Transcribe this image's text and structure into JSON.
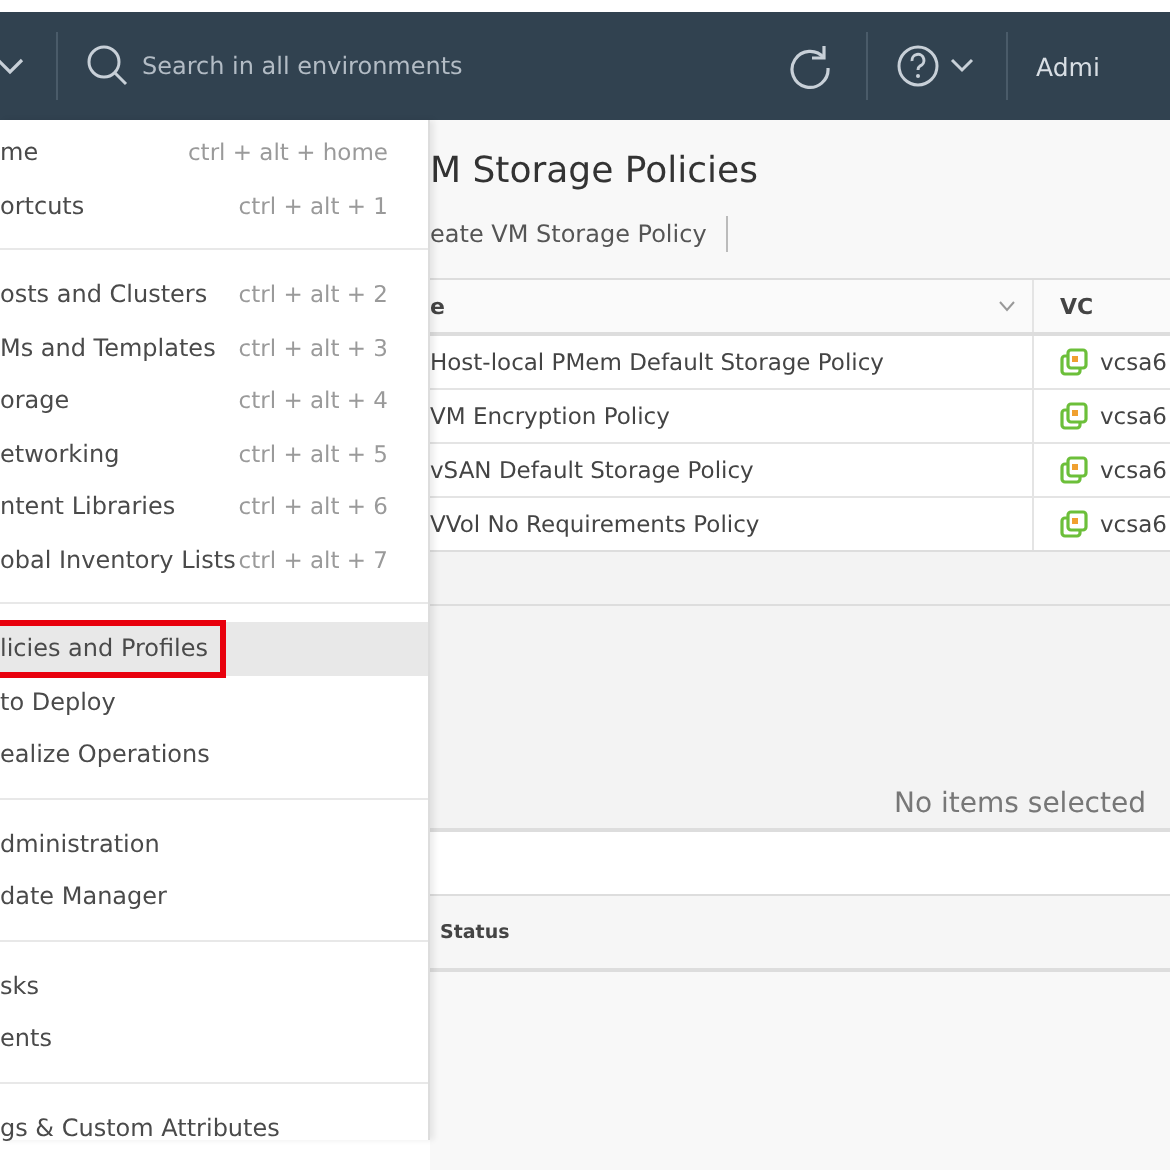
{
  "header": {
    "search": {
      "placeholder": "Search in all environments"
    },
    "user": "Admi"
  },
  "menu": {
    "groups": [
      [
        {
          "label": "me",
          "shortcut": "ctrl + alt + home",
          "selected": false,
          "highlighted": false
        },
        {
          "label": "ortcuts",
          "shortcut": "ctrl + alt + 1",
          "selected": false,
          "highlighted": false
        }
      ],
      [
        {
          "label": "osts and Clusters",
          "shortcut": "ctrl + alt + 2",
          "selected": false,
          "highlighted": false
        },
        {
          "label": "Ms and Templates",
          "shortcut": "ctrl + alt + 3",
          "selected": false,
          "highlighted": false
        },
        {
          "label": "orage",
          "shortcut": "ctrl + alt + 4",
          "selected": false,
          "highlighted": false
        },
        {
          "label": "etworking",
          "shortcut": "ctrl + alt + 5",
          "selected": false,
          "highlighted": false
        },
        {
          "label": "ntent Libraries",
          "shortcut": "ctrl + alt + 6",
          "selected": false,
          "highlighted": false
        },
        {
          "label": "obal Inventory Lists",
          "shortcut": "ctrl + alt + 7",
          "selected": false,
          "highlighted": false
        }
      ],
      [
        {
          "label": "licies and Profiles",
          "selected": true,
          "highlighted": true
        },
        {
          "label": "to Deploy",
          "selected": false,
          "highlighted": false
        },
        {
          "label": "ealize Operations",
          "selected": false,
          "highlighted": false
        }
      ],
      [
        {
          "label": "dministration",
          "selected": false,
          "highlighted": false
        },
        {
          "label": "date Manager",
          "selected": false,
          "highlighted": false
        }
      ],
      [
        {
          "label": "sks",
          "selected": false,
          "highlighted": false
        },
        {
          "label": "ents",
          "selected": false,
          "highlighted": false
        }
      ],
      [
        {
          "label": "gs & Custom Attributes",
          "selected": false,
          "highlighted": false
        }
      ]
    ]
  },
  "page": {
    "title": "M Storage Policies",
    "action": "eate VM Storage Policy",
    "table": {
      "columns": [
        "e",
        "VC"
      ],
      "rows": [
        [
          "Host-local PMem Default Storage Policy",
          "vcsa6"
        ],
        [
          "VM Encryption Policy",
          "vcsa6"
        ],
        [
          "vSAN Default Storage Policy",
          "vcsa6"
        ],
        [
          "VVol No Requirements Policy",
          "vcsa6"
        ]
      ]
    },
    "details": {
      "empty_text": "No items selected"
    },
    "tasks": {
      "columns": [
        "Status"
      ]
    }
  }
}
